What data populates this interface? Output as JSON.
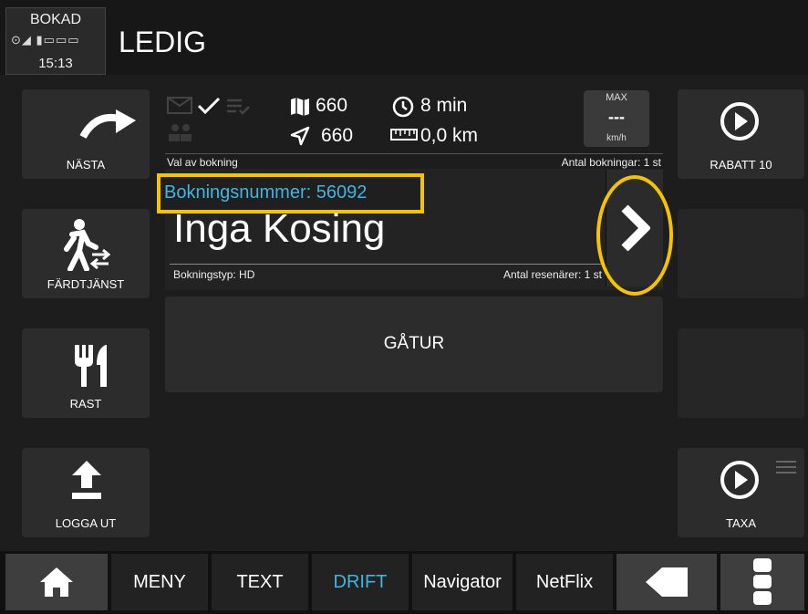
{
  "status": {
    "booked_label": "BOKAD",
    "status_icons_text": "⊙◢ ▮▭▭▭",
    "time": "15:13"
  },
  "header": {
    "title": "LEDIG"
  },
  "left_buttons": [
    {
      "label": "NÄSTA",
      "icon": "redo-arrow-icon"
    },
    {
      "label": "FÄRDTJÄNST",
      "icon": "walking-person-icon"
    },
    {
      "label": "RAST",
      "icon": "fork-knife-icon"
    },
    {
      "label": "LOGGA UT",
      "icon": "upload-arrow-icon"
    }
  ],
  "right_buttons": [
    {
      "label": "RABATT 10",
      "icon": "play-circle-icon"
    },
    {
      "label": "TAXA",
      "icon": "play-circle-icon"
    }
  ],
  "info": {
    "map_value": "660",
    "time_value": "8 min",
    "nav_value": "660",
    "distance_value": "0,0 km",
    "max_label": "MAX",
    "max_value": "---",
    "max_unit": "km/h",
    "selection_label": "Val av bokning",
    "bookings_count_label": "Antal bokningar: 1 st"
  },
  "booking": {
    "number_label": "Bokningsnummer: 56092",
    "name": "Inga Kosing",
    "type_label": "Bokningstyp: HD",
    "passengers_label": "Antal resenärer: 1 st"
  },
  "trip": {
    "label": "GÅTUR"
  },
  "tabs": [
    {
      "label": "",
      "icon": "home-icon"
    },
    {
      "label": "MENY"
    },
    {
      "label": "TEXT"
    },
    {
      "label": "DRIFT",
      "active": true
    },
    {
      "label": "Navigator"
    },
    {
      "label": "NetFlix"
    },
    {
      "label": "",
      "icon": "back-arrow-icon"
    },
    {
      "label": "",
      "icon": "more-icon"
    }
  ],
  "colors": {
    "accent": "#3fb6e0",
    "highlight": "#f5c400"
  }
}
